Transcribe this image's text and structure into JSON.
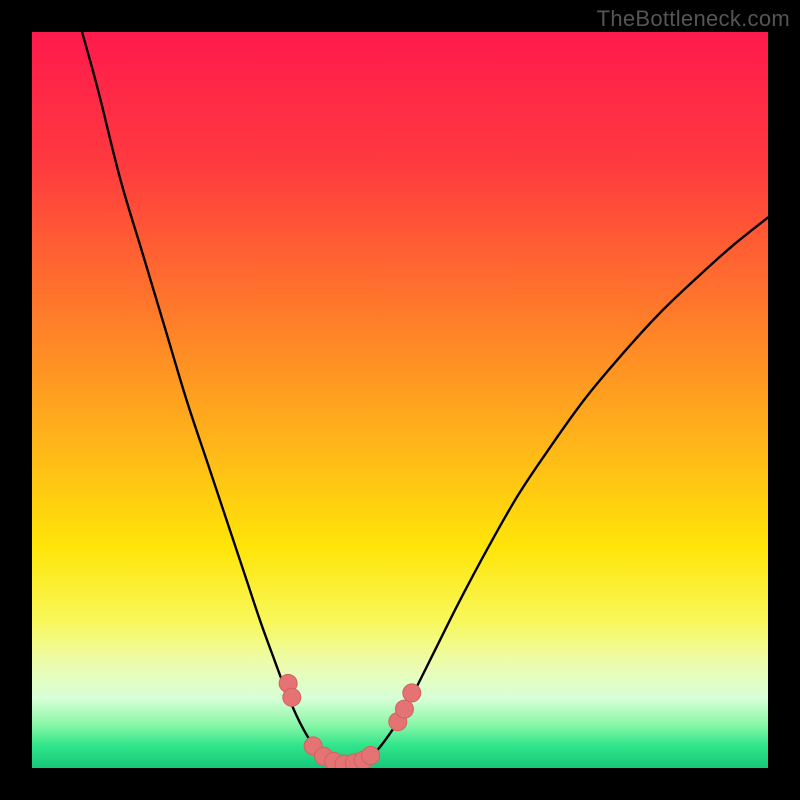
{
  "watermark": "TheBottleneck.com",
  "colors": {
    "frame": "#000000",
    "gradient_stops": [
      {
        "offset": 0.0,
        "color": "#ff1a4d"
      },
      {
        "offset": 0.18,
        "color": "#ff3a3f"
      },
      {
        "offset": 0.38,
        "color": "#ff7a2a"
      },
      {
        "offset": 0.55,
        "color": "#ffb21a"
      },
      {
        "offset": 0.7,
        "color": "#ffe508"
      },
      {
        "offset": 0.8,
        "color": "#f8f85a"
      },
      {
        "offset": 0.86,
        "color": "#ecfcb0"
      },
      {
        "offset": 0.905,
        "color": "#d8ffd8"
      },
      {
        "offset": 0.94,
        "color": "#8cf7a8"
      },
      {
        "offset": 0.97,
        "color": "#2fe58a"
      },
      {
        "offset": 1.0,
        "color": "#16c77a"
      }
    ],
    "curve": "#000000",
    "marker_fill": "#e57373",
    "marker_stroke": "#d06262"
  },
  "chart_data": {
    "type": "line",
    "title": "",
    "xlabel": "",
    "ylabel": "",
    "xlim": [
      0,
      100
    ],
    "ylim": [
      0,
      100
    ],
    "grid": false,
    "curve_left": [
      {
        "x": 6.8,
        "y": 100.0
      },
      {
        "x": 9.0,
        "y": 92.0
      },
      {
        "x": 12.0,
        "y": 80.0
      },
      {
        "x": 15.0,
        "y": 70.0
      },
      {
        "x": 18.0,
        "y": 60.0
      },
      {
        "x": 21.0,
        "y": 50.0
      },
      {
        "x": 24.0,
        "y": 41.0
      },
      {
        "x": 27.0,
        "y": 32.0
      },
      {
        "x": 29.0,
        "y": 26.0
      },
      {
        "x": 31.0,
        "y": 20.0
      },
      {
        "x": 33.0,
        "y": 14.5
      },
      {
        "x": 34.5,
        "y": 10.5
      },
      {
        "x": 36.0,
        "y": 7.0
      },
      {
        "x": 37.5,
        "y": 4.2
      },
      {
        "x": 39.0,
        "y": 2.2
      },
      {
        "x": 40.5,
        "y": 1.0
      },
      {
        "x": 42.0,
        "y": 0.55
      }
    ],
    "curve_right": [
      {
        "x": 42.0,
        "y": 0.55
      },
      {
        "x": 43.5,
        "y": 0.55
      },
      {
        "x": 45.0,
        "y": 1.0
      },
      {
        "x": 46.5,
        "y": 2.0
      },
      {
        "x": 48.0,
        "y": 3.8
      },
      {
        "x": 50.0,
        "y": 6.8
      },
      {
        "x": 52.0,
        "y": 10.5
      },
      {
        "x": 55.0,
        "y": 16.5
      },
      {
        "x": 58.0,
        "y": 22.5
      },
      {
        "x": 62.0,
        "y": 30.0
      },
      {
        "x": 66.0,
        "y": 37.0
      },
      {
        "x": 70.0,
        "y": 43.0
      },
      {
        "x": 75.0,
        "y": 50.0
      },
      {
        "x": 80.0,
        "y": 56.0
      },
      {
        "x": 85.0,
        "y": 61.5
      },
      {
        "x": 90.0,
        "y": 66.3
      },
      {
        "x": 95.0,
        "y": 70.8
      },
      {
        "x": 100.0,
        "y": 74.8
      }
    ],
    "markers": [
      {
        "x": 34.8,
        "y": 11.5
      },
      {
        "x": 35.3,
        "y": 9.6
      },
      {
        "x": 38.2,
        "y": 3.0
      },
      {
        "x": 39.6,
        "y": 1.6
      },
      {
        "x": 41.0,
        "y": 0.9
      },
      {
        "x": 42.4,
        "y": 0.55
      },
      {
        "x": 43.8,
        "y": 0.7
      },
      {
        "x": 45.0,
        "y": 1.05
      },
      {
        "x": 46.0,
        "y": 1.7
      },
      {
        "x": 49.7,
        "y": 6.3
      },
      {
        "x": 50.6,
        "y": 8.0
      },
      {
        "x": 51.6,
        "y": 10.2
      }
    ],
    "marker_radius_px": 9
  }
}
